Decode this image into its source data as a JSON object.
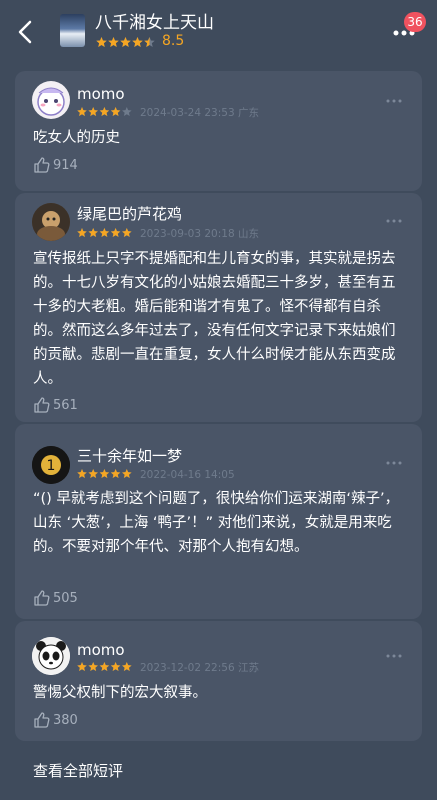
{
  "header": {
    "title": "八千湘女上天山",
    "score": "8.5",
    "rating_stars": 4.5,
    "badge_count": "36",
    "icons": [
      "back-icon",
      "more-icon"
    ]
  },
  "reviews": [
    {
      "username": "momo",
      "stars": 4,
      "datetime": "2024-03-24 23:53",
      "location": "广东",
      "text": "吃女人的历史",
      "likes": "914"
    },
    {
      "username": "绿尾巴的芦花鸡",
      "stars": 5,
      "datetime": "2023-09-03 20:18",
      "location": "山东",
      "text": "宣传报纸上只字不提婚配和生儿育女的事，其实就是拐去的。十七八岁有文化的小姑娘去婚配三十多岁，甚至有五十多的大老粗。婚后能和谐才有鬼了。怪不得都有自杀的。然而这么多年过去了，没有任何文字记录下来姑娘们的贡献。悲剧一直在重复，女人什么时候才能从东西变成人。",
      "likes": "561"
    },
    {
      "username": "三十余年如一梦",
      "stars": 5,
      "datetime": "2022-04-16 14:05",
      "location": "",
      "text": "“() 早就考虑到这个问题了，很快给你们运来湖南‘辣子’，山东 ‘大葱’，上海 ‘鸭子’！” 对他们来说，女就是用来吃的。不要对那个年代、对那个人抱有幻想。",
      "likes": "505"
    },
    {
      "username": "momo",
      "stars": 5,
      "datetime": "2023-12-02 22:56",
      "location": "江苏",
      "text": "警惕父权制下的宏大叙事。",
      "likes": "380"
    }
  ],
  "footer": {
    "see_all": "查看全部短评"
  },
  "colors": {
    "background": "#3f4b5c",
    "card": "#4a5567",
    "star": "#f5a623",
    "meta": "#6f7b8c",
    "like": "#a7b0bd",
    "badge": "#f0525f"
  }
}
